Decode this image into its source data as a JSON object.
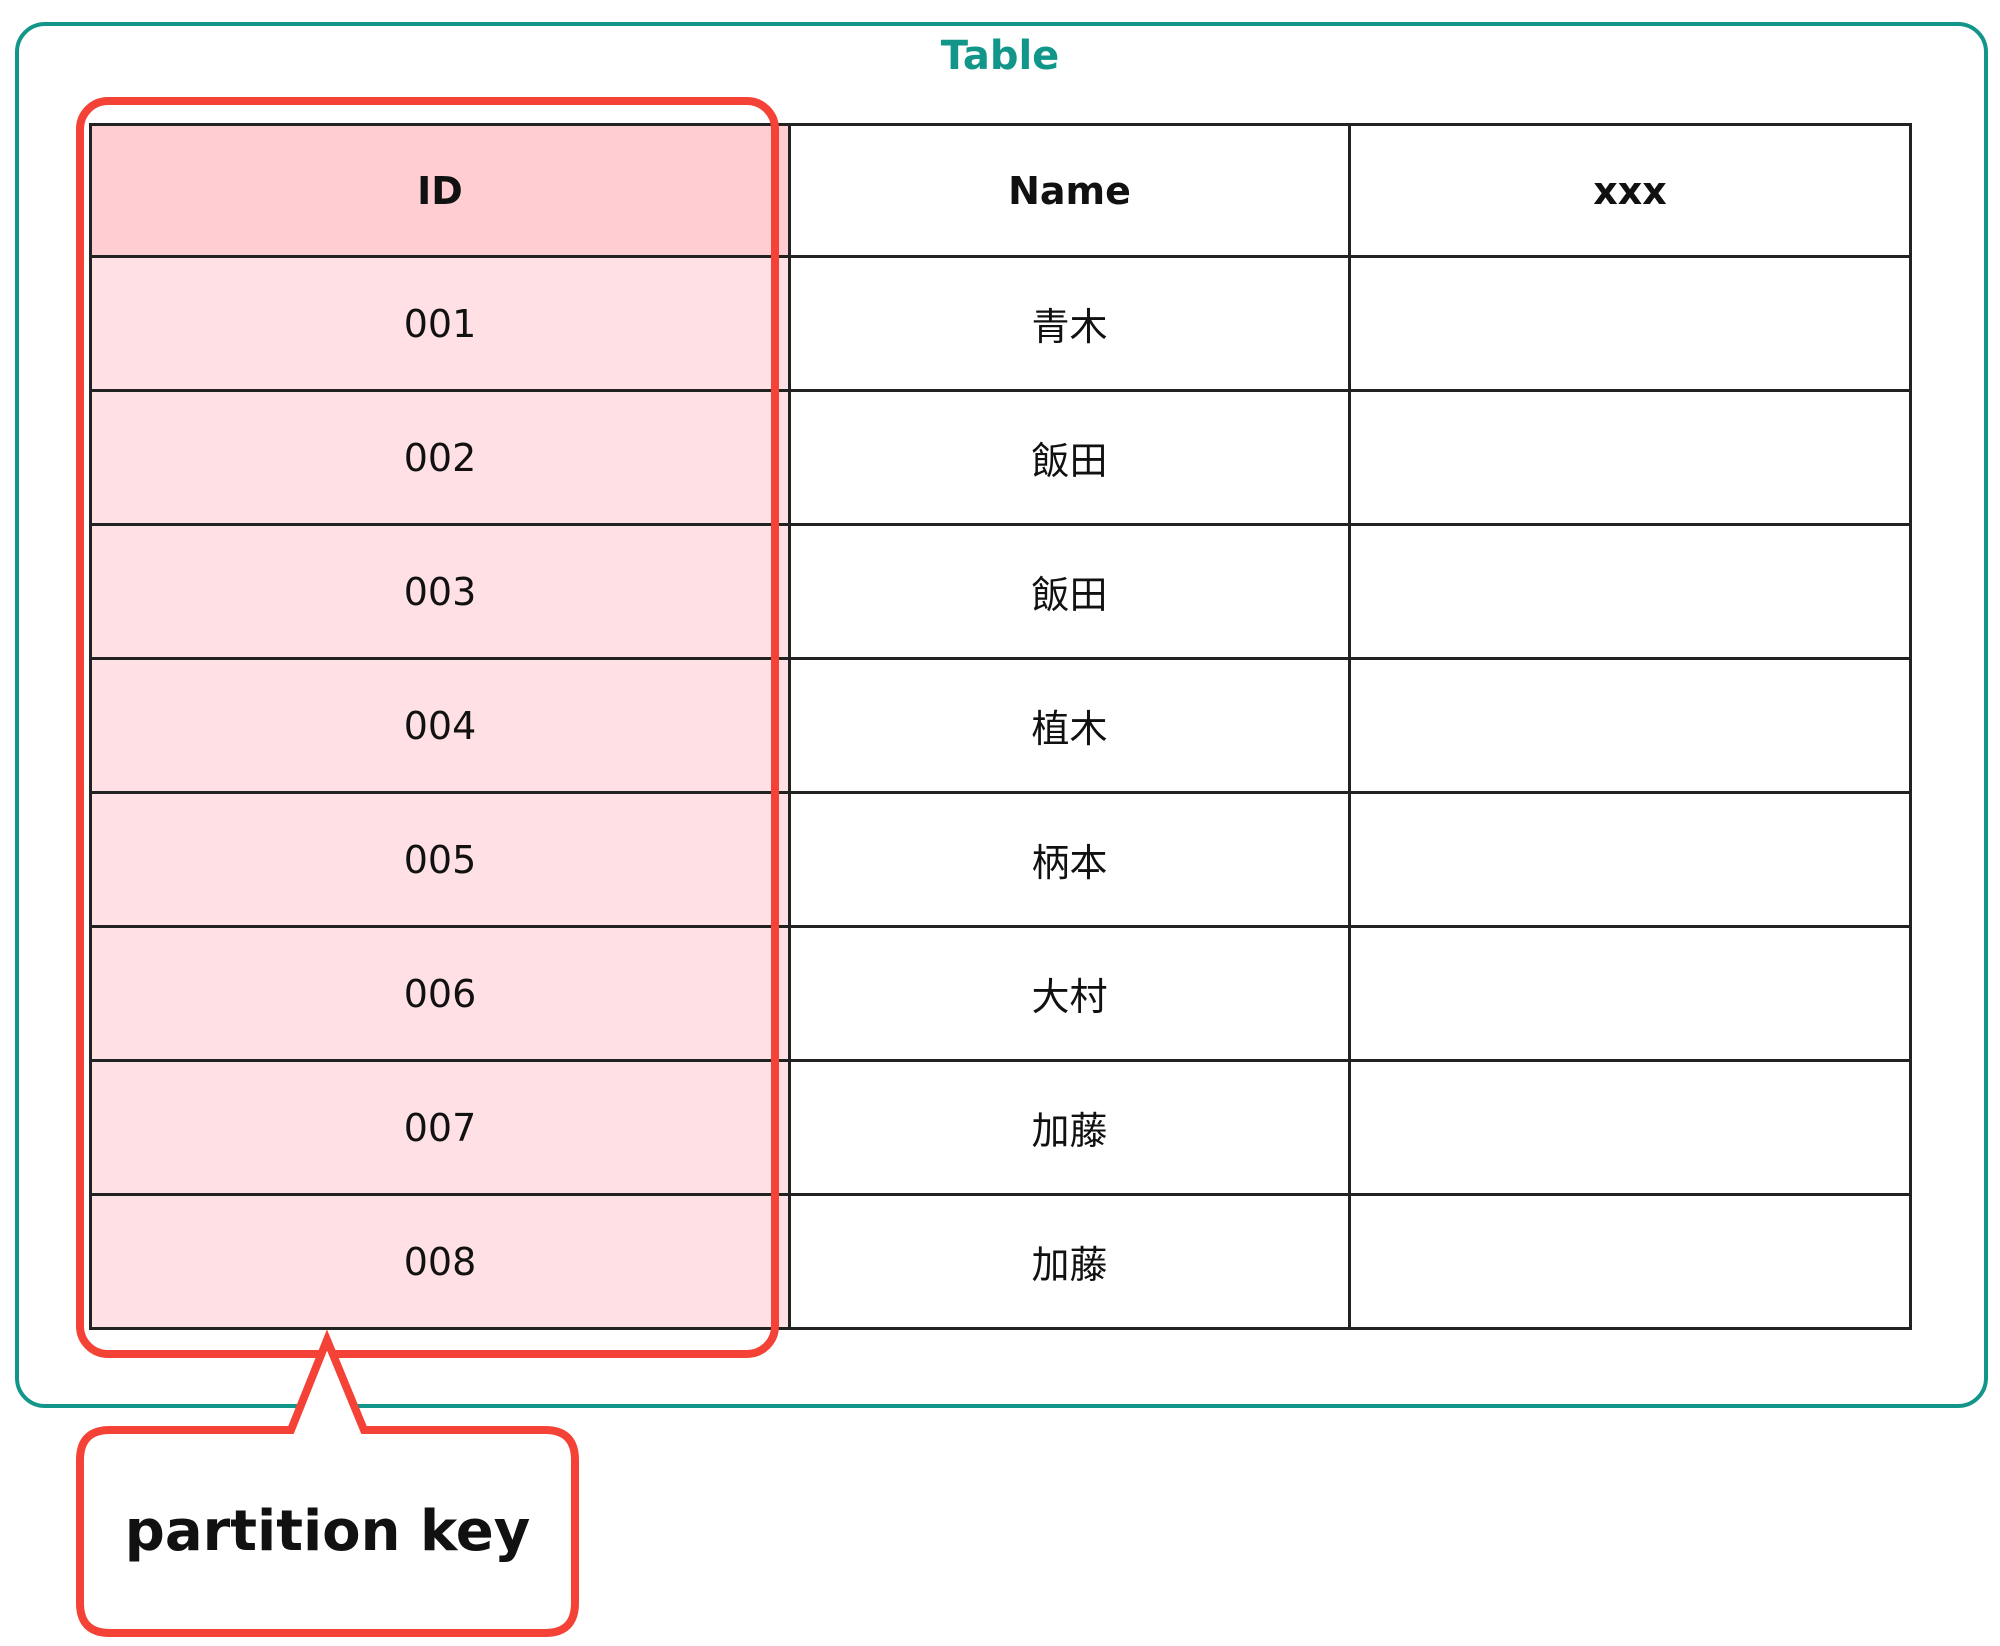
{
  "diagram": {
    "frame_title": "Table",
    "colors": {
      "frame": "#13968A",
      "highlight": "#F44336",
      "key_header_fill": "#FFCDD2",
      "key_cell_fill": "#FFE1E5"
    },
    "table": {
      "columns": [
        "ID",
        "Name",
        "xxx"
      ],
      "rows": [
        {
          "id": "001",
          "name": "青木",
          "xxx": ""
        },
        {
          "id": "002",
          "name": "飯田",
          "xxx": ""
        },
        {
          "id": "003",
          "name": "飯田",
          "xxx": ""
        },
        {
          "id": "004",
          "name": "植木",
          "xxx": ""
        },
        {
          "id": "005",
          "name": "柄本",
          "xxx": ""
        },
        {
          "id": "006",
          "name": "大村",
          "xxx": ""
        },
        {
          "id": "007",
          "name": "加藤",
          "xxx": ""
        },
        {
          "id": "008",
          "name": "加藤",
          "xxx": ""
        }
      ]
    },
    "highlighted_column": "ID",
    "callout": {
      "label": "partition key"
    }
  }
}
